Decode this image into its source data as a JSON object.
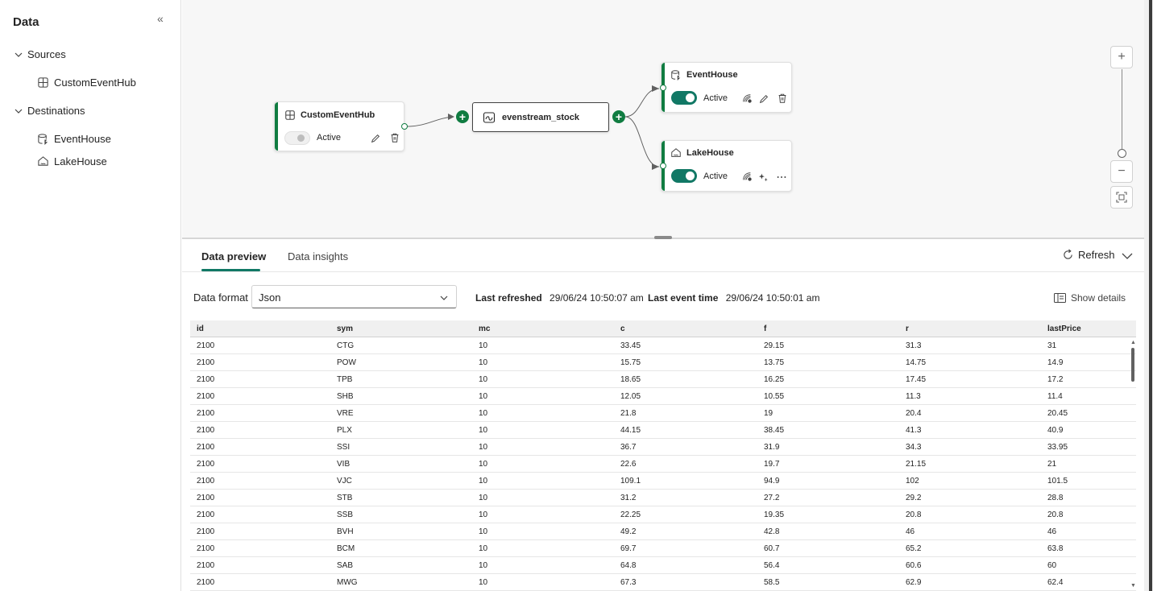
{
  "left_panel": {
    "title": "Data",
    "sources_label": "Sources",
    "sources": [
      {
        "label": "CustomEventHub",
        "icon": "grid-icon"
      }
    ],
    "destinations_label": "Destinations",
    "destinations": [
      {
        "label": "EventHouse",
        "icon": "eventhouse-icon"
      },
      {
        "label": "LakeHouse",
        "icon": "lakehouse-icon"
      }
    ]
  },
  "canvas": {
    "source_node": {
      "title": "CustomEventHub",
      "status": "Active",
      "enabled": false
    },
    "stream_node": {
      "title": "evenstream_stock"
    },
    "destinations": [
      {
        "title": "EventHouse",
        "status": "Active",
        "enabled": true
      },
      {
        "title": "LakeHouse",
        "status": "Active",
        "enabled": true
      }
    ],
    "zoom_in": "+",
    "zoom_out": "−"
  },
  "preview": {
    "tabs": [
      "Data preview",
      "Data insights"
    ],
    "active_tab": "Data preview",
    "refresh_label": "Refresh",
    "format_label": "Data format",
    "format_value": "Json",
    "last_refreshed_label": "Last refreshed",
    "last_refreshed_value": "29/06/24 10:50:07 am",
    "last_event_label": "Last event time",
    "last_event_value": "29/06/24 10:50:01 am",
    "show_details_label": "Show details",
    "columns": [
      "id",
      "sym",
      "mc",
      "c",
      "f",
      "r",
      "lastPrice"
    ],
    "rows": [
      [
        "2100",
        "CTG",
        "10",
        "33.45",
        "29.15",
        "31.3",
        "31"
      ],
      [
        "2100",
        "POW",
        "10",
        "15.75",
        "13.75",
        "14.75",
        "14.9"
      ],
      [
        "2100",
        "TPB",
        "10",
        "18.65",
        "16.25",
        "17.45",
        "17.2"
      ],
      [
        "2100",
        "SHB",
        "10",
        "12.05",
        "10.55",
        "11.3",
        "11.4"
      ],
      [
        "2100",
        "VRE",
        "10",
        "21.8",
        "19",
        "20.4",
        "20.45"
      ],
      [
        "2100",
        "PLX",
        "10",
        "44.15",
        "38.45",
        "41.3",
        "40.9"
      ],
      [
        "2100",
        "SSI",
        "10",
        "36.7",
        "31.9",
        "34.3",
        "33.95"
      ],
      [
        "2100",
        "VIB",
        "10",
        "22.6",
        "19.7",
        "21.15",
        "21"
      ],
      [
        "2100",
        "VJC",
        "10",
        "109.1",
        "94.9",
        "102",
        "101.5"
      ],
      [
        "2100",
        "STB",
        "10",
        "31.2",
        "27.2",
        "29.2",
        "28.8"
      ],
      [
        "2100",
        "SSB",
        "10",
        "22.25",
        "19.35",
        "20.8",
        "20.8"
      ],
      [
        "2100",
        "BVH",
        "10",
        "49.2",
        "42.8",
        "46",
        "46"
      ],
      [
        "2100",
        "BCM",
        "10",
        "69.7",
        "60.7",
        "65.2",
        "63.8"
      ],
      [
        "2100",
        "SAB",
        "10",
        "64.8",
        "56.4",
        "60.6",
        "60"
      ],
      [
        "2100",
        "MWG",
        "10",
        "67.3",
        "58.5",
        "62.9",
        "62.4"
      ]
    ]
  },
  "colors": {
    "accent": "#117865",
    "node_accent": "#107c41"
  }
}
